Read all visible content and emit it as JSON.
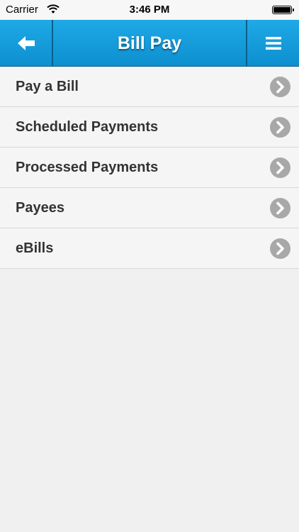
{
  "status_bar": {
    "carrier": "Carrier",
    "time": "3:46 PM",
    "wifi_icon": "wifi-icon",
    "battery_icon": "battery-icon"
  },
  "header": {
    "title": "Bill Pay",
    "back_icon": "arrow-left-icon",
    "menu_icon": "hamburger-menu-icon",
    "background_color": "#1fa9e6"
  },
  "menu": {
    "items": [
      {
        "label": "Pay a Bill"
      },
      {
        "label": "Scheduled Payments"
      },
      {
        "label": "Processed Payments"
      },
      {
        "label": "Payees"
      },
      {
        "label": "eBills"
      }
    ],
    "chevron_icon": "chevron-right-circle-icon",
    "chevron_color": "#a8a8a8"
  }
}
